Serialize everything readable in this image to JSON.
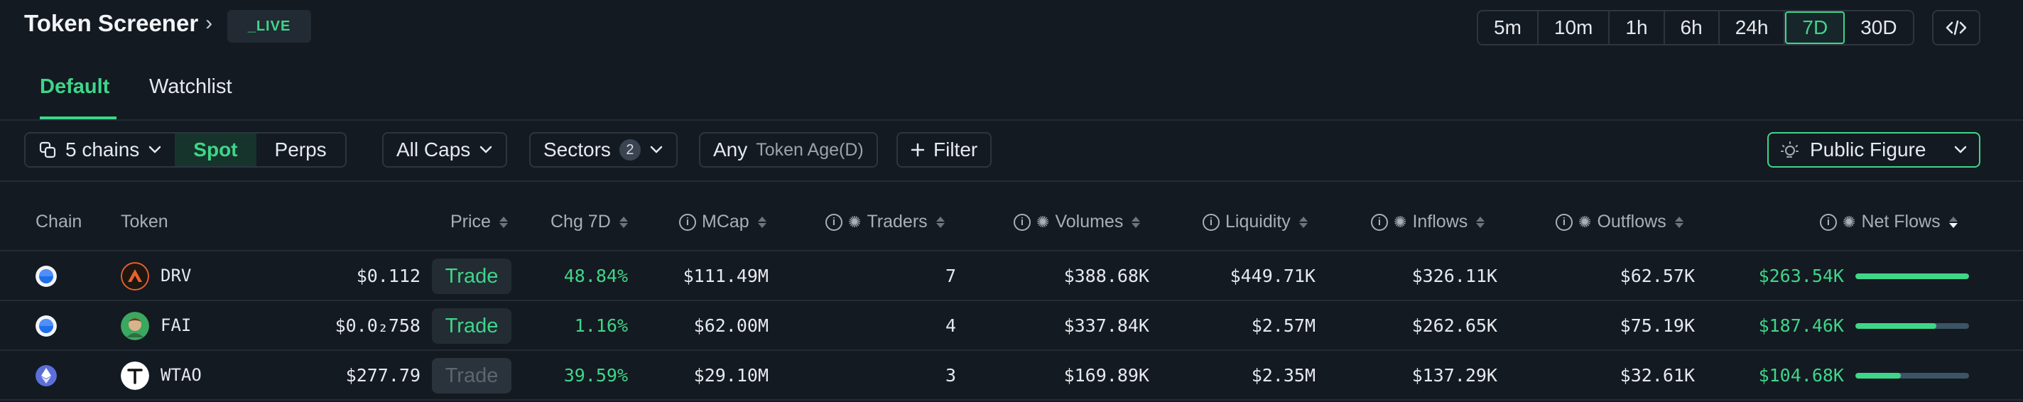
{
  "header": {
    "title": "Token Screener",
    "live_badge": "_LIVE",
    "timeframes": [
      "5m",
      "10m",
      "1h",
      "6h",
      "24h",
      "7D",
      "30D"
    ],
    "active_timeframe": "7D"
  },
  "tabs": [
    {
      "label": "Default",
      "active": true
    },
    {
      "label": "Watchlist",
      "active": false
    }
  ],
  "filters": {
    "chains": "5 chains",
    "spot": "Spot",
    "perps": "Perps",
    "caps": "All Caps",
    "sectors": "Sectors",
    "sectors_count": "2",
    "age_value": "Any",
    "age_label": "Token Age(D)",
    "filter": "Filter",
    "public_figure": "Public Figure"
  },
  "columns": {
    "chain": "Chain",
    "token": "Token",
    "price": "Price",
    "chg": "Chg 7D",
    "mcap": "MCap",
    "traders": "Traders",
    "volumes": "Volumes",
    "liquidity": "Liquidity",
    "inflows": "Inflows",
    "outflows": "Outflows",
    "netflows": "Net Flows"
  },
  "rows": [
    {
      "chain": "base",
      "token": "DRV",
      "price": "$0.112",
      "trade": "Trade",
      "trade_enabled": true,
      "chg": "48.84%",
      "mcap": "$111.49M",
      "traders": "7",
      "volumes": "$388.68K",
      "liquidity": "$449.71K",
      "inflows": "$326.11K",
      "outflows": "$62.57K",
      "netflows": "$263.54K",
      "netflow_bar": 1.0
    },
    {
      "chain": "base",
      "token": "FAI",
      "price": "$0.0₂758",
      "trade": "Trade",
      "trade_enabled": true,
      "chg": "1.16%",
      "mcap": "$62.00M",
      "traders": "4",
      "volumes": "$337.84K",
      "liquidity": "$2.57M",
      "inflows": "$262.65K",
      "outflows": "$75.19K",
      "netflows": "$187.46K",
      "netflow_bar": 0.71
    },
    {
      "chain": "ethereum",
      "token": "WTAO",
      "price": "$277.79",
      "trade": "Trade",
      "trade_enabled": false,
      "chg": "39.59%",
      "mcap": "$29.10M",
      "traders": "3",
      "volumes": "$169.89K",
      "liquidity": "$2.35M",
      "inflows": "$137.29K",
      "outflows": "$32.61K",
      "netflows": "$104.68K",
      "netflow_bar": 0.4
    }
  ],
  "colors": {
    "accent": "#3ed68a",
    "background": "#141a21"
  }
}
